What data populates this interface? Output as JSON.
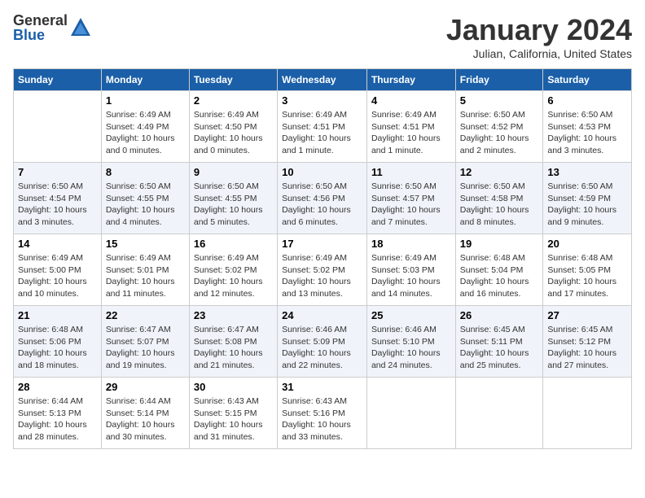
{
  "header": {
    "logo_general": "General",
    "logo_blue": "Blue",
    "month_title": "January 2024",
    "location": "Julian, California, United States"
  },
  "days_of_week": [
    "Sunday",
    "Monday",
    "Tuesday",
    "Wednesday",
    "Thursday",
    "Friday",
    "Saturday"
  ],
  "weeks": [
    {
      "days": [
        {
          "num": "",
          "empty": true
        },
        {
          "num": "1",
          "sunrise": "Sunrise: 6:49 AM",
          "sunset": "Sunset: 4:49 PM",
          "daylight": "Daylight: 10 hours and 0 minutes."
        },
        {
          "num": "2",
          "sunrise": "Sunrise: 6:49 AM",
          "sunset": "Sunset: 4:50 PM",
          "daylight": "Daylight: 10 hours and 0 minutes."
        },
        {
          "num": "3",
          "sunrise": "Sunrise: 6:49 AM",
          "sunset": "Sunset: 4:51 PM",
          "daylight": "Daylight: 10 hours and 1 minute."
        },
        {
          "num": "4",
          "sunrise": "Sunrise: 6:49 AM",
          "sunset": "Sunset: 4:51 PM",
          "daylight": "Daylight: 10 hours and 1 minute."
        },
        {
          "num": "5",
          "sunrise": "Sunrise: 6:50 AM",
          "sunset": "Sunset: 4:52 PM",
          "daylight": "Daylight: 10 hours and 2 minutes."
        },
        {
          "num": "6",
          "sunrise": "Sunrise: 6:50 AM",
          "sunset": "Sunset: 4:53 PM",
          "daylight": "Daylight: 10 hours and 3 minutes."
        }
      ]
    },
    {
      "days": [
        {
          "num": "7",
          "sunrise": "Sunrise: 6:50 AM",
          "sunset": "Sunset: 4:54 PM",
          "daylight": "Daylight: 10 hours and 3 minutes."
        },
        {
          "num": "8",
          "sunrise": "Sunrise: 6:50 AM",
          "sunset": "Sunset: 4:55 PM",
          "daylight": "Daylight: 10 hours and 4 minutes."
        },
        {
          "num": "9",
          "sunrise": "Sunrise: 6:50 AM",
          "sunset": "Sunset: 4:55 PM",
          "daylight": "Daylight: 10 hours and 5 minutes."
        },
        {
          "num": "10",
          "sunrise": "Sunrise: 6:50 AM",
          "sunset": "Sunset: 4:56 PM",
          "daylight": "Daylight: 10 hours and 6 minutes."
        },
        {
          "num": "11",
          "sunrise": "Sunrise: 6:50 AM",
          "sunset": "Sunset: 4:57 PM",
          "daylight": "Daylight: 10 hours and 7 minutes."
        },
        {
          "num": "12",
          "sunrise": "Sunrise: 6:50 AM",
          "sunset": "Sunset: 4:58 PM",
          "daylight": "Daylight: 10 hours and 8 minutes."
        },
        {
          "num": "13",
          "sunrise": "Sunrise: 6:50 AM",
          "sunset": "Sunset: 4:59 PM",
          "daylight": "Daylight: 10 hours and 9 minutes."
        }
      ]
    },
    {
      "days": [
        {
          "num": "14",
          "sunrise": "Sunrise: 6:49 AM",
          "sunset": "Sunset: 5:00 PM",
          "daylight": "Daylight: 10 hours and 10 minutes."
        },
        {
          "num": "15",
          "sunrise": "Sunrise: 6:49 AM",
          "sunset": "Sunset: 5:01 PM",
          "daylight": "Daylight: 10 hours and 11 minutes."
        },
        {
          "num": "16",
          "sunrise": "Sunrise: 6:49 AM",
          "sunset": "Sunset: 5:02 PM",
          "daylight": "Daylight: 10 hours and 12 minutes."
        },
        {
          "num": "17",
          "sunrise": "Sunrise: 6:49 AM",
          "sunset": "Sunset: 5:02 PM",
          "daylight": "Daylight: 10 hours and 13 minutes."
        },
        {
          "num": "18",
          "sunrise": "Sunrise: 6:49 AM",
          "sunset": "Sunset: 5:03 PM",
          "daylight": "Daylight: 10 hours and 14 minutes."
        },
        {
          "num": "19",
          "sunrise": "Sunrise: 6:48 AM",
          "sunset": "Sunset: 5:04 PM",
          "daylight": "Daylight: 10 hours and 16 minutes."
        },
        {
          "num": "20",
          "sunrise": "Sunrise: 6:48 AM",
          "sunset": "Sunset: 5:05 PM",
          "daylight": "Daylight: 10 hours and 17 minutes."
        }
      ]
    },
    {
      "days": [
        {
          "num": "21",
          "sunrise": "Sunrise: 6:48 AM",
          "sunset": "Sunset: 5:06 PM",
          "daylight": "Daylight: 10 hours and 18 minutes."
        },
        {
          "num": "22",
          "sunrise": "Sunrise: 6:47 AM",
          "sunset": "Sunset: 5:07 PM",
          "daylight": "Daylight: 10 hours and 19 minutes."
        },
        {
          "num": "23",
          "sunrise": "Sunrise: 6:47 AM",
          "sunset": "Sunset: 5:08 PM",
          "daylight": "Daylight: 10 hours and 21 minutes."
        },
        {
          "num": "24",
          "sunrise": "Sunrise: 6:46 AM",
          "sunset": "Sunset: 5:09 PM",
          "daylight": "Daylight: 10 hours and 22 minutes."
        },
        {
          "num": "25",
          "sunrise": "Sunrise: 6:46 AM",
          "sunset": "Sunset: 5:10 PM",
          "daylight": "Daylight: 10 hours and 24 minutes."
        },
        {
          "num": "26",
          "sunrise": "Sunrise: 6:45 AM",
          "sunset": "Sunset: 5:11 PM",
          "daylight": "Daylight: 10 hours and 25 minutes."
        },
        {
          "num": "27",
          "sunrise": "Sunrise: 6:45 AM",
          "sunset": "Sunset: 5:12 PM",
          "daylight": "Daylight: 10 hours and 27 minutes."
        }
      ]
    },
    {
      "days": [
        {
          "num": "28",
          "sunrise": "Sunrise: 6:44 AM",
          "sunset": "Sunset: 5:13 PM",
          "daylight": "Daylight: 10 hours and 28 minutes."
        },
        {
          "num": "29",
          "sunrise": "Sunrise: 6:44 AM",
          "sunset": "Sunset: 5:14 PM",
          "daylight": "Daylight: 10 hours and 30 minutes."
        },
        {
          "num": "30",
          "sunrise": "Sunrise: 6:43 AM",
          "sunset": "Sunset: 5:15 PM",
          "daylight": "Daylight: 10 hours and 31 minutes."
        },
        {
          "num": "31",
          "sunrise": "Sunrise: 6:43 AM",
          "sunset": "Sunset: 5:16 PM",
          "daylight": "Daylight: 10 hours and 33 minutes."
        },
        {
          "num": "",
          "empty": true
        },
        {
          "num": "",
          "empty": true
        },
        {
          "num": "",
          "empty": true
        }
      ]
    }
  ]
}
